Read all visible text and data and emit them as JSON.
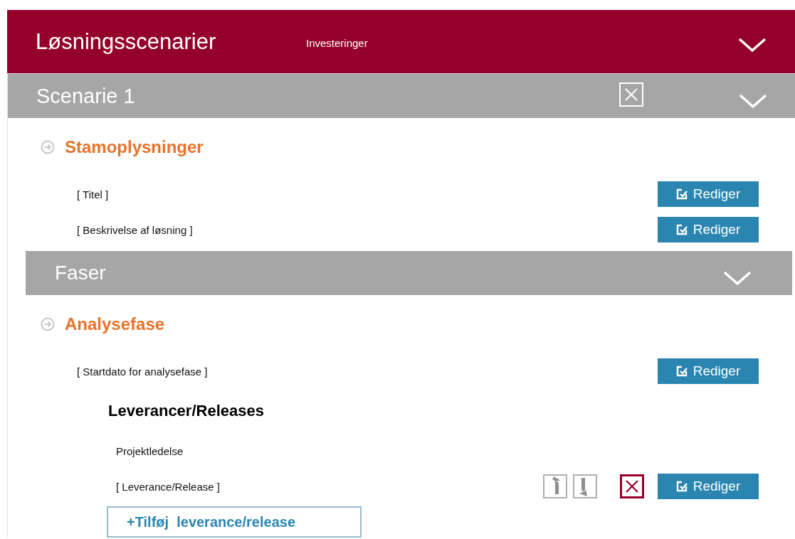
{
  "header": {
    "title": "Løsningsscenarier",
    "subtitle": "Investeringer"
  },
  "scenario": {
    "title": "Scenarie 1"
  },
  "master": {
    "heading": "Stamoplysninger",
    "fields": [
      {
        "label": "[ Titel ]",
        "button": "Rediger"
      },
      {
        "label": "[ Beskrivelse af løsning ]",
        "button": "Rediger"
      }
    ]
  },
  "phases": {
    "title": "Faser"
  },
  "phase": {
    "heading": "Analysefase",
    "fields": [
      {
        "label": "[ Startdato for analysefase ]",
        "button": "Rediger"
      }
    ]
  },
  "deliverables": {
    "heading": "Leverancer/Releases",
    "rows": [
      {
        "kind": "group",
        "label": "Projektledelse"
      },
      {
        "kind": "item",
        "label": "[ Leverance/Release ]",
        "button": "Rediger"
      }
    ],
    "add_button": "+Tilføj  leverance/release"
  }
}
